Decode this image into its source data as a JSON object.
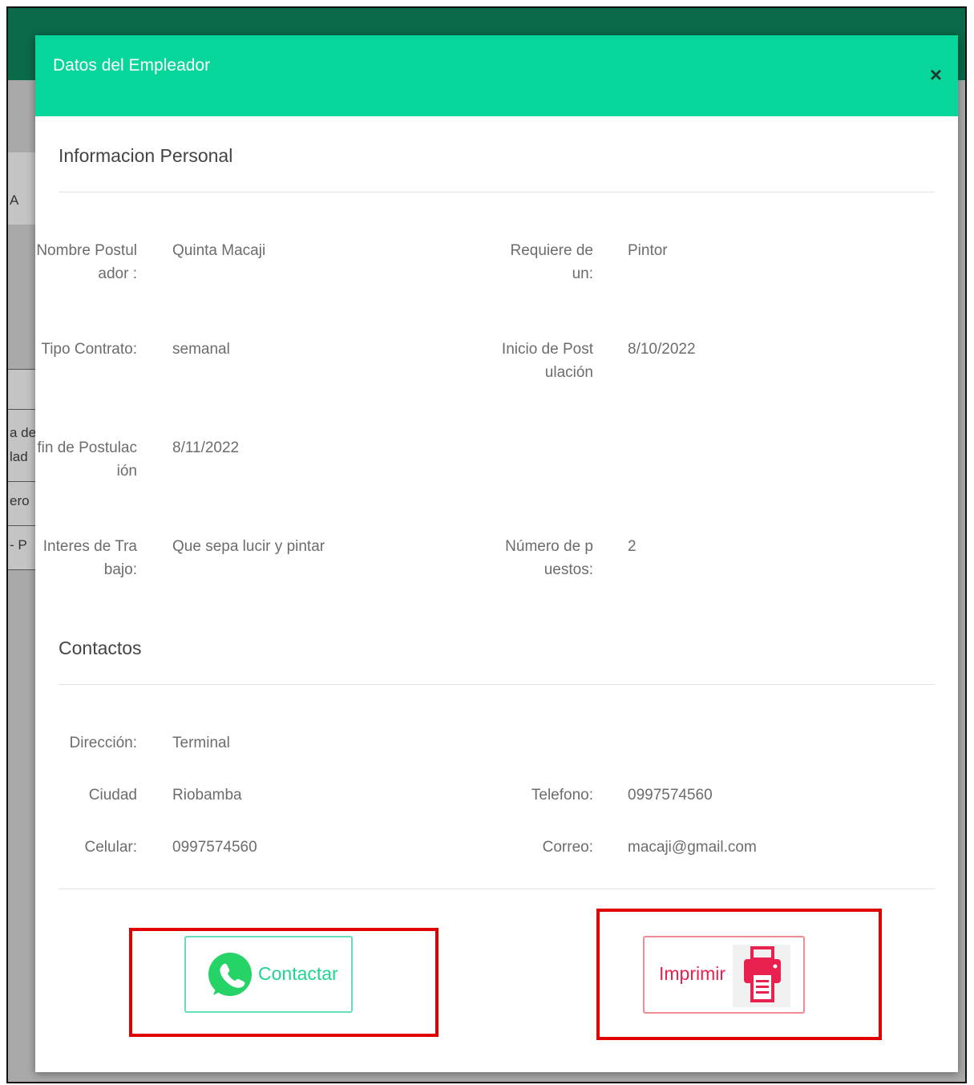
{
  "background": {
    "fragments": [
      "A",
      "a de",
      "lad",
      "ero",
      "- P"
    ]
  },
  "modal": {
    "title": "Datos del Empleador",
    "close_label": "×"
  },
  "personal": {
    "section_title": "Informacion Personal",
    "fields": {
      "nombre_label": "Nombre Postulador :",
      "nombre_value": "Quinta Macaji",
      "requiere_label": "Requiere de un:",
      "requiere_value": "Pintor",
      "tipo_label": "Tipo Contrato:",
      "tipo_value": "semanal",
      "inicio_label": "Inicio de Postulación",
      "inicio_value": "8/10/2022",
      "fin_label": "fin de Postulación",
      "fin_value": "8/11/2022",
      "interes_label": "Interes de Trabajo:",
      "interes_value": "Que sepa lucir y pintar",
      "numero_label": "Número de puestos:",
      "numero_value": "2"
    }
  },
  "contacts": {
    "section_title": "Contactos",
    "fields": {
      "direccion_label": "Dirección:",
      "direccion_value": "Terminal",
      "ciudad_label": "Ciudad",
      "ciudad_value": "Riobamba",
      "telefono_label": "Telefono:",
      "telefono_value": "0997574560",
      "celular_label": "Celular:",
      "celular_value": "0997574560",
      "correo_label": "Correo:",
      "correo_value": "macaji@gmail.com"
    }
  },
  "actions": {
    "contact_label": "Contactar",
    "contact_icon": "whatsapp-icon",
    "print_label": "Imprimir",
    "print_icon": "printer-icon"
  },
  "colors": {
    "header": "#07d69a",
    "whatsapp": "#25d366",
    "print": "#e8214e",
    "highlight": "#e00000"
  }
}
